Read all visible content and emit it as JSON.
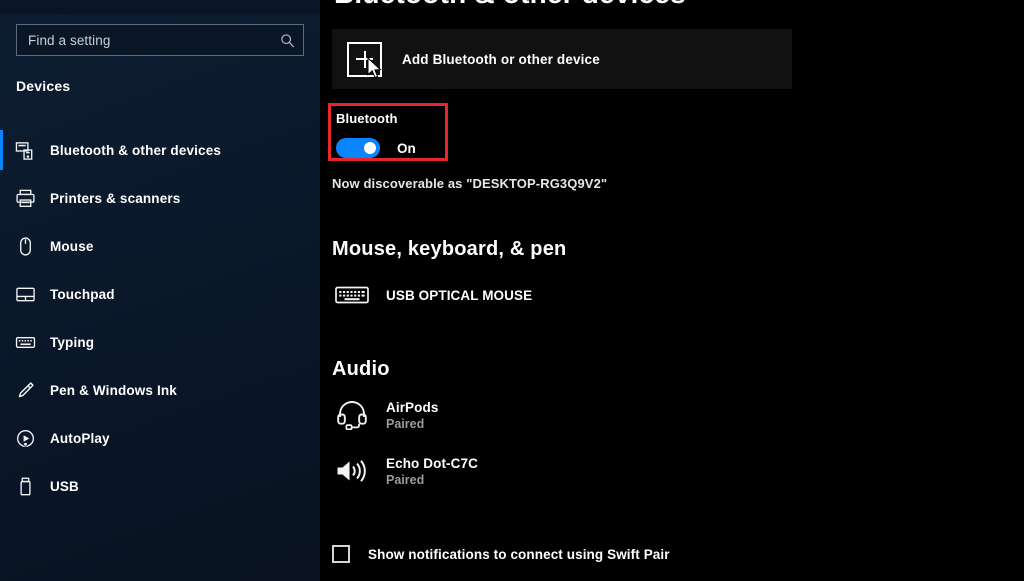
{
  "sidebar": {
    "search": {
      "placeholder": "Find a setting",
      "value": "",
      "icon": "search-icon"
    },
    "heading": "Devices",
    "items": [
      {
        "label": "Bluetooth & other devices",
        "icon": "bluetooth-devices-icon",
        "selected": true
      },
      {
        "label": "Printers & scanners",
        "icon": "printer-icon",
        "selected": false
      },
      {
        "label": "Mouse",
        "icon": "mouse-icon",
        "selected": false
      },
      {
        "label": "Touchpad",
        "icon": "touchpad-icon",
        "selected": false
      },
      {
        "label": "Typing",
        "icon": "keyboard-icon",
        "selected": false
      },
      {
        "label": "Pen & Windows Ink",
        "icon": "pen-icon",
        "selected": false
      },
      {
        "label": "AutoPlay",
        "icon": "autoplay-icon",
        "selected": false
      },
      {
        "label": "USB",
        "icon": "usb-icon",
        "selected": false
      }
    ]
  },
  "main": {
    "page_title": "Bluetooth & other devices",
    "add_device": {
      "label": "Add Bluetooth or other device",
      "icon": "plus-icon"
    },
    "bluetooth": {
      "label": "Bluetooth",
      "state": "On",
      "discoverable_text": "Now discoverable as \"DESKTOP-RG3Q9V2\""
    },
    "sections": [
      {
        "title": "Mouse, keyboard, & pen",
        "devices": [
          {
            "name": "USB OPTICAL MOUSE",
            "status": "",
            "icon": "keyboard-icon"
          }
        ]
      },
      {
        "title": "Audio",
        "devices": [
          {
            "name": "AirPods",
            "status": "Paired",
            "icon": "headset-icon"
          },
          {
            "name": "Echo Dot-C7C",
            "status": "Paired",
            "icon": "speaker-icon"
          }
        ]
      }
    ],
    "swift_pair": {
      "label": "Show notifications to connect using Swift Pair",
      "checked": false
    }
  },
  "colors": {
    "accent_blue": "#0a84ff",
    "highlight_red": "#e8252a",
    "sidebar_bg": "#0b1a2e",
    "main_bg": "#000000"
  }
}
